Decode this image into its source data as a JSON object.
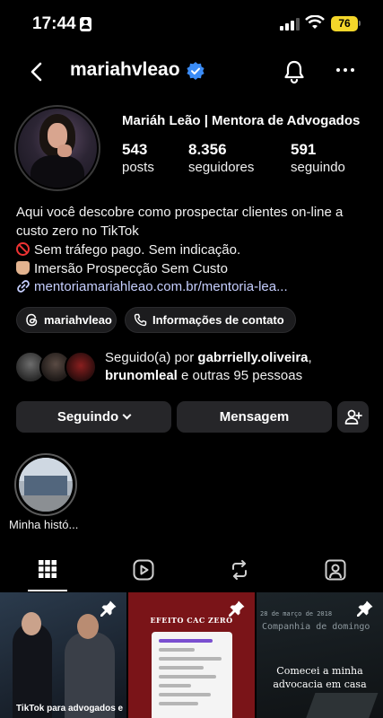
{
  "status_bar": {
    "time": "17:44",
    "battery": "76"
  },
  "header": {
    "username": "mariahvleao"
  },
  "profile": {
    "display_name": "Mariáh Leão | Mentora de Advogados",
    "stats": [
      {
        "value": "543",
        "label": "posts"
      },
      {
        "value": "8.356",
        "label": "seguidores"
      },
      {
        "value": "591",
        "label": "seguindo"
      }
    ],
    "bio": {
      "line1": "Aqui você descobre como prospectar clientes on-line a",
      "line2": "custo zero no TikTok",
      "line3": "Sem tráfego pago. Sem indicação.",
      "line4": "Imersão Prospecção Sem Custo"
    },
    "link": "mentoriamariahleao.com.br/mentoria-lea..."
  },
  "chips": {
    "threads_label": "mariahvleao",
    "contact_label": "Informações de contato"
  },
  "followed_by": {
    "prefix": "Seguido(a) por ",
    "user1": "gabrrielly.oliveira",
    "sep": ",",
    "user2": "brunomleal",
    "suffix": " e outras 95 pessoas"
  },
  "actions": {
    "following_label": "Seguindo",
    "message_label": "Mensagem"
  },
  "highlights": [
    {
      "label": "Minha histó..."
    }
  ],
  "tabs": [
    {
      "name": "grid",
      "icon": "grid-icon",
      "active": true
    },
    {
      "name": "reels",
      "icon": "reels-icon",
      "active": false
    },
    {
      "name": "reposts",
      "icon": "repost-icon",
      "active": false
    },
    {
      "name": "tagged",
      "icon": "tagged-icon",
      "active": false
    }
  ],
  "posts": [
    {
      "caption": "TikTok para advogados e",
      "pinned": true
    },
    {
      "title": "EFEITO CAC ZERO",
      "pinned": true
    },
    {
      "top_text": "28 de março de 2018",
      "sub_text": "Companhia de domingo",
      "caption": "Comecei a minha advocacia em casa",
      "pinned": true
    }
  ],
  "colors": {
    "accent_link": "#c6cfff",
    "verified_blue": "#3b8cf6",
    "button_bg": "#262629",
    "battery": "#f4d62a"
  }
}
